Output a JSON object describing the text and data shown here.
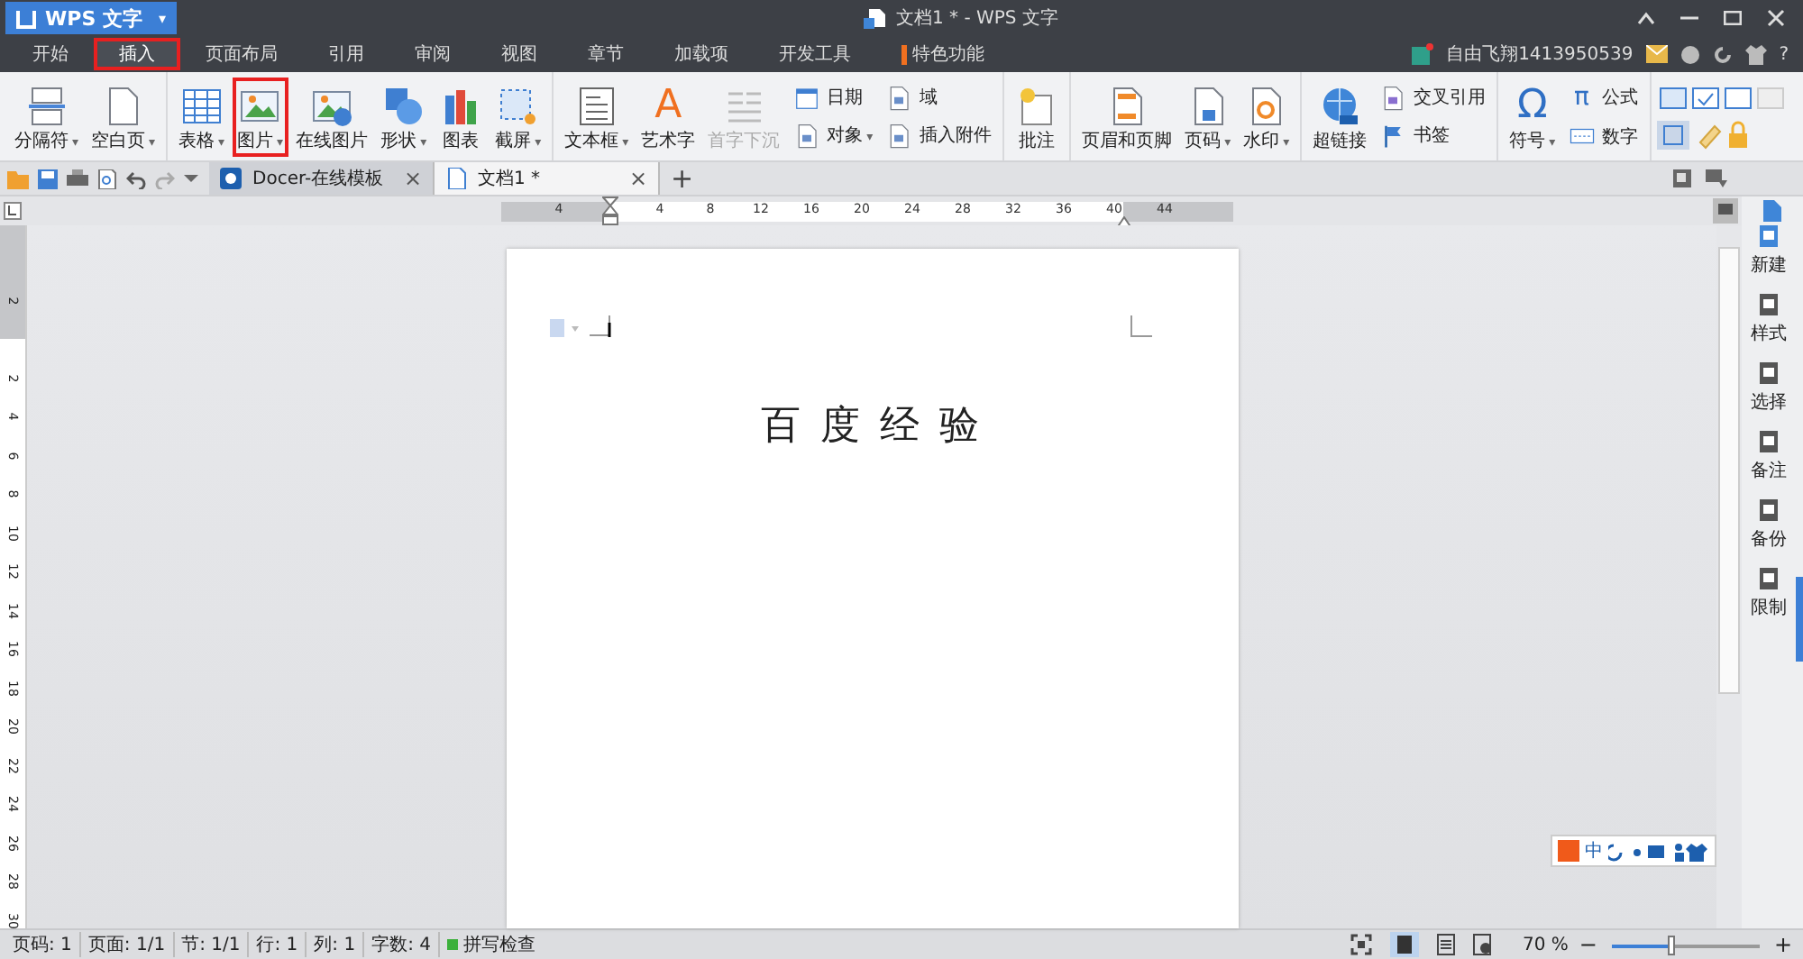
{
  "app_button": {
    "label": "WPS 文字",
    "caret": "▾"
  },
  "window": {
    "title": "文档1 * - WPS 文字"
  },
  "account": {
    "user": "自由飞翔1413950539",
    "help": "?"
  },
  "menu_tabs": [
    {
      "label": "开始",
      "selected": false,
      "highlighted": false,
      "marker": false
    },
    {
      "label": "插入",
      "selected": true,
      "highlighted": true,
      "marker": false
    },
    {
      "label": "页面布局",
      "selected": false,
      "highlighted": false,
      "marker": false
    },
    {
      "label": "引用",
      "selected": false,
      "highlighted": false,
      "marker": false
    },
    {
      "label": "审阅",
      "selected": false,
      "highlighted": false,
      "marker": false
    },
    {
      "label": "视图",
      "selected": false,
      "highlighted": false,
      "marker": false
    },
    {
      "label": "章节",
      "selected": false,
      "highlighted": false,
      "marker": false
    },
    {
      "label": "加载项",
      "selected": false,
      "highlighted": false,
      "marker": false
    },
    {
      "label": "开发工具",
      "selected": false,
      "highlighted": false,
      "marker": false
    },
    {
      "label": "特色功能",
      "selected": false,
      "highlighted": false,
      "marker": true
    }
  ],
  "ribbon": {
    "groups": [
      {
        "items": [
          {
            "kind": "large",
            "label": "分隔符",
            "caret": "▾",
            "highlighted": false,
            "disabled": false
          },
          {
            "kind": "large",
            "label": "空白页",
            "caret": "▾",
            "highlighted": false,
            "disabled": false
          }
        ]
      },
      {
        "items": [
          {
            "kind": "large",
            "label": "表格",
            "caret": "▾",
            "highlighted": false,
            "disabled": false
          },
          {
            "kind": "large",
            "label": "图片",
            "caret": "▾",
            "highlighted": true,
            "disabled": false
          },
          {
            "kind": "large",
            "label": "在线图片",
            "highlighted": false,
            "disabled": false
          },
          {
            "kind": "large",
            "label": "形状",
            "caret": "▾",
            "highlighted": false,
            "disabled": false
          },
          {
            "kind": "large",
            "label": "图表",
            "highlighted": false,
            "disabled": false
          },
          {
            "kind": "large",
            "label": "截屏",
            "caret": "▾",
            "highlighted": false,
            "disabled": false
          }
        ]
      },
      {
        "items": [
          {
            "kind": "large",
            "label": "文本框",
            "caret": "▾",
            "highlighted": false,
            "disabled": false
          },
          {
            "kind": "large",
            "label": "艺术字",
            "glyph": "A",
            "highlighted": false,
            "disabled": false
          },
          {
            "kind": "large",
            "label": "首字下沉",
            "highlighted": false,
            "disabled": true
          },
          {
            "kind": "stack",
            "rows": [
              {
                "label": "日期"
              },
              {
                "label": "对象",
                "caret": "▾"
              }
            ]
          },
          {
            "kind": "stack",
            "rows": [
              {
                "label": "域"
              },
              {
                "label": "插入附件"
              }
            ]
          }
        ]
      },
      {
        "items": [
          {
            "kind": "large",
            "label": "批注",
            "highlighted": false,
            "disabled": false
          }
        ]
      },
      {
        "items": [
          {
            "kind": "large",
            "label": "页眉和页脚",
            "highlighted": false,
            "disabled": false
          },
          {
            "kind": "large",
            "label": "页码",
            "caret": "▾",
            "highlighted": false,
            "disabled": false
          },
          {
            "kind": "large",
            "label": "水印",
            "caret": "▾",
            "highlighted": false,
            "disabled": false
          }
        ]
      },
      {
        "items": [
          {
            "kind": "large",
            "label": "超链接",
            "highlighted": false,
            "disabled": false
          },
          {
            "kind": "stack",
            "rows": [
              {
                "label": "交叉引用"
              },
              {
                "label": "书签"
              }
            ]
          }
        ]
      },
      {
        "items": [
          {
            "kind": "large",
            "label": "符号",
            "glyph": "Ω",
            "caret": "▾",
            "highlighted": false,
            "disabled": false
          },
          {
            "kind": "stack",
            "rows": [
              {
                "label": "公式",
                "glyph": "π"
              },
              {
                "label": "数字"
              }
            ]
          }
        ]
      }
    ]
  },
  "doc_tabs": [
    {
      "label": "Docer-在线模板",
      "selected": false,
      "close": "×"
    },
    {
      "label": "文档1 *",
      "selected": true,
      "close": "×"
    }
  ],
  "new_tab": "+",
  "ruler": {
    "horizontal": [
      "4",
      "4",
      "8",
      "12",
      "16",
      "20",
      "24",
      "28",
      "32",
      "36",
      "40",
      "44"
    ],
    "vertical": [
      "2",
      "2",
      "4",
      "6",
      "8",
      "10",
      "12",
      "14",
      "16",
      "18",
      "20",
      "22",
      "24",
      "26",
      "28",
      "30"
    ]
  },
  "document": {
    "text": "百 度 经 验"
  },
  "sidebar": [
    "新建",
    "样式",
    "选择",
    "备注",
    "备份",
    "限制"
  ],
  "ime_bar": {
    "mode": "中"
  },
  "status_bar": {
    "fields": [
      "页码: 1",
      "页面: 1/1",
      "节: 1/1",
      "行: 1",
      "列: 1",
      "字数: 4"
    ],
    "spell_check": "拼写检查",
    "zoom": "70 %",
    "zoom_slider": {
      "level": 0.41
    },
    "minus": "−",
    "plus": "+"
  }
}
